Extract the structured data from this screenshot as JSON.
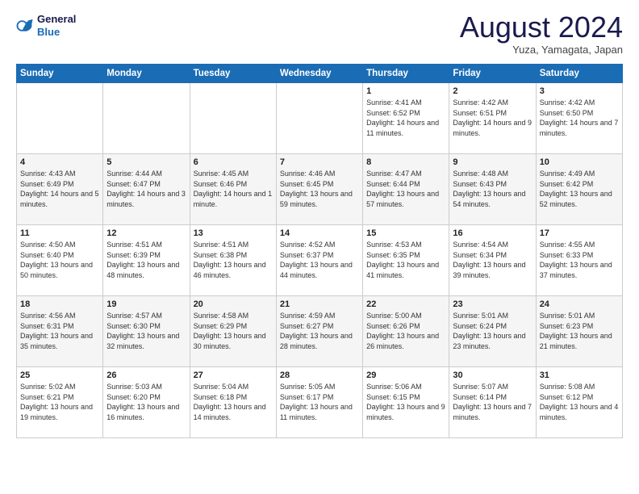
{
  "logo": {
    "line1": "General",
    "line2": "Blue"
  },
  "header": {
    "month_year": "August 2024",
    "location": "Yuza, Yamagata, Japan"
  },
  "weekdays": [
    "Sunday",
    "Monday",
    "Tuesday",
    "Wednesday",
    "Thursday",
    "Friday",
    "Saturday"
  ],
  "weeks": [
    [
      {
        "day": "",
        "sunrise": "",
        "sunset": "",
        "daylight": ""
      },
      {
        "day": "",
        "sunrise": "",
        "sunset": "",
        "daylight": ""
      },
      {
        "day": "",
        "sunrise": "",
        "sunset": "",
        "daylight": ""
      },
      {
        "day": "",
        "sunrise": "",
        "sunset": "",
        "daylight": ""
      },
      {
        "day": "1",
        "sunrise": "Sunrise: 4:41 AM",
        "sunset": "Sunset: 6:52 PM",
        "daylight": "Daylight: 14 hours and 11 minutes."
      },
      {
        "day": "2",
        "sunrise": "Sunrise: 4:42 AM",
        "sunset": "Sunset: 6:51 PM",
        "daylight": "Daylight: 14 hours and 9 minutes."
      },
      {
        "day": "3",
        "sunrise": "Sunrise: 4:42 AM",
        "sunset": "Sunset: 6:50 PM",
        "daylight": "Daylight: 14 hours and 7 minutes."
      }
    ],
    [
      {
        "day": "4",
        "sunrise": "Sunrise: 4:43 AM",
        "sunset": "Sunset: 6:49 PM",
        "daylight": "Daylight: 14 hours and 5 minutes."
      },
      {
        "day": "5",
        "sunrise": "Sunrise: 4:44 AM",
        "sunset": "Sunset: 6:47 PM",
        "daylight": "Daylight: 14 hours and 3 minutes."
      },
      {
        "day": "6",
        "sunrise": "Sunrise: 4:45 AM",
        "sunset": "Sunset: 6:46 PM",
        "daylight": "Daylight: 14 hours and 1 minute."
      },
      {
        "day": "7",
        "sunrise": "Sunrise: 4:46 AM",
        "sunset": "Sunset: 6:45 PM",
        "daylight": "Daylight: 13 hours and 59 minutes."
      },
      {
        "day": "8",
        "sunrise": "Sunrise: 4:47 AM",
        "sunset": "Sunset: 6:44 PM",
        "daylight": "Daylight: 13 hours and 57 minutes."
      },
      {
        "day": "9",
        "sunrise": "Sunrise: 4:48 AM",
        "sunset": "Sunset: 6:43 PM",
        "daylight": "Daylight: 13 hours and 54 minutes."
      },
      {
        "day": "10",
        "sunrise": "Sunrise: 4:49 AM",
        "sunset": "Sunset: 6:42 PM",
        "daylight": "Daylight: 13 hours and 52 minutes."
      }
    ],
    [
      {
        "day": "11",
        "sunrise": "Sunrise: 4:50 AM",
        "sunset": "Sunset: 6:40 PM",
        "daylight": "Daylight: 13 hours and 50 minutes."
      },
      {
        "day": "12",
        "sunrise": "Sunrise: 4:51 AM",
        "sunset": "Sunset: 6:39 PM",
        "daylight": "Daylight: 13 hours and 48 minutes."
      },
      {
        "day": "13",
        "sunrise": "Sunrise: 4:51 AM",
        "sunset": "Sunset: 6:38 PM",
        "daylight": "Daylight: 13 hours and 46 minutes."
      },
      {
        "day": "14",
        "sunrise": "Sunrise: 4:52 AM",
        "sunset": "Sunset: 6:37 PM",
        "daylight": "Daylight: 13 hours and 44 minutes."
      },
      {
        "day": "15",
        "sunrise": "Sunrise: 4:53 AM",
        "sunset": "Sunset: 6:35 PM",
        "daylight": "Daylight: 13 hours and 41 minutes."
      },
      {
        "day": "16",
        "sunrise": "Sunrise: 4:54 AM",
        "sunset": "Sunset: 6:34 PM",
        "daylight": "Daylight: 13 hours and 39 minutes."
      },
      {
        "day": "17",
        "sunrise": "Sunrise: 4:55 AM",
        "sunset": "Sunset: 6:33 PM",
        "daylight": "Daylight: 13 hours and 37 minutes."
      }
    ],
    [
      {
        "day": "18",
        "sunrise": "Sunrise: 4:56 AM",
        "sunset": "Sunset: 6:31 PM",
        "daylight": "Daylight: 13 hours and 35 minutes."
      },
      {
        "day": "19",
        "sunrise": "Sunrise: 4:57 AM",
        "sunset": "Sunset: 6:30 PM",
        "daylight": "Daylight: 13 hours and 32 minutes."
      },
      {
        "day": "20",
        "sunrise": "Sunrise: 4:58 AM",
        "sunset": "Sunset: 6:29 PM",
        "daylight": "Daylight: 13 hours and 30 minutes."
      },
      {
        "day": "21",
        "sunrise": "Sunrise: 4:59 AM",
        "sunset": "Sunset: 6:27 PM",
        "daylight": "Daylight: 13 hours and 28 minutes."
      },
      {
        "day": "22",
        "sunrise": "Sunrise: 5:00 AM",
        "sunset": "Sunset: 6:26 PM",
        "daylight": "Daylight: 13 hours and 26 minutes."
      },
      {
        "day": "23",
        "sunrise": "Sunrise: 5:01 AM",
        "sunset": "Sunset: 6:24 PM",
        "daylight": "Daylight: 13 hours and 23 minutes."
      },
      {
        "day": "24",
        "sunrise": "Sunrise: 5:01 AM",
        "sunset": "Sunset: 6:23 PM",
        "daylight": "Daylight: 13 hours and 21 minutes."
      }
    ],
    [
      {
        "day": "25",
        "sunrise": "Sunrise: 5:02 AM",
        "sunset": "Sunset: 6:21 PM",
        "daylight": "Daylight: 13 hours and 19 minutes."
      },
      {
        "day": "26",
        "sunrise": "Sunrise: 5:03 AM",
        "sunset": "Sunset: 6:20 PM",
        "daylight": "Daylight: 13 hours and 16 minutes."
      },
      {
        "day": "27",
        "sunrise": "Sunrise: 5:04 AM",
        "sunset": "Sunset: 6:18 PM",
        "daylight": "Daylight: 13 hours and 14 minutes."
      },
      {
        "day": "28",
        "sunrise": "Sunrise: 5:05 AM",
        "sunset": "Sunset: 6:17 PM",
        "daylight": "Daylight: 13 hours and 11 minutes."
      },
      {
        "day": "29",
        "sunrise": "Sunrise: 5:06 AM",
        "sunset": "Sunset: 6:15 PM",
        "daylight": "Daylight: 13 hours and 9 minutes."
      },
      {
        "day": "30",
        "sunrise": "Sunrise: 5:07 AM",
        "sunset": "Sunset: 6:14 PM",
        "daylight": "Daylight: 13 hours and 7 minutes."
      },
      {
        "day": "31",
        "sunrise": "Sunrise: 5:08 AM",
        "sunset": "Sunset: 6:12 PM",
        "daylight": "Daylight: 13 hours and 4 minutes."
      }
    ]
  ]
}
